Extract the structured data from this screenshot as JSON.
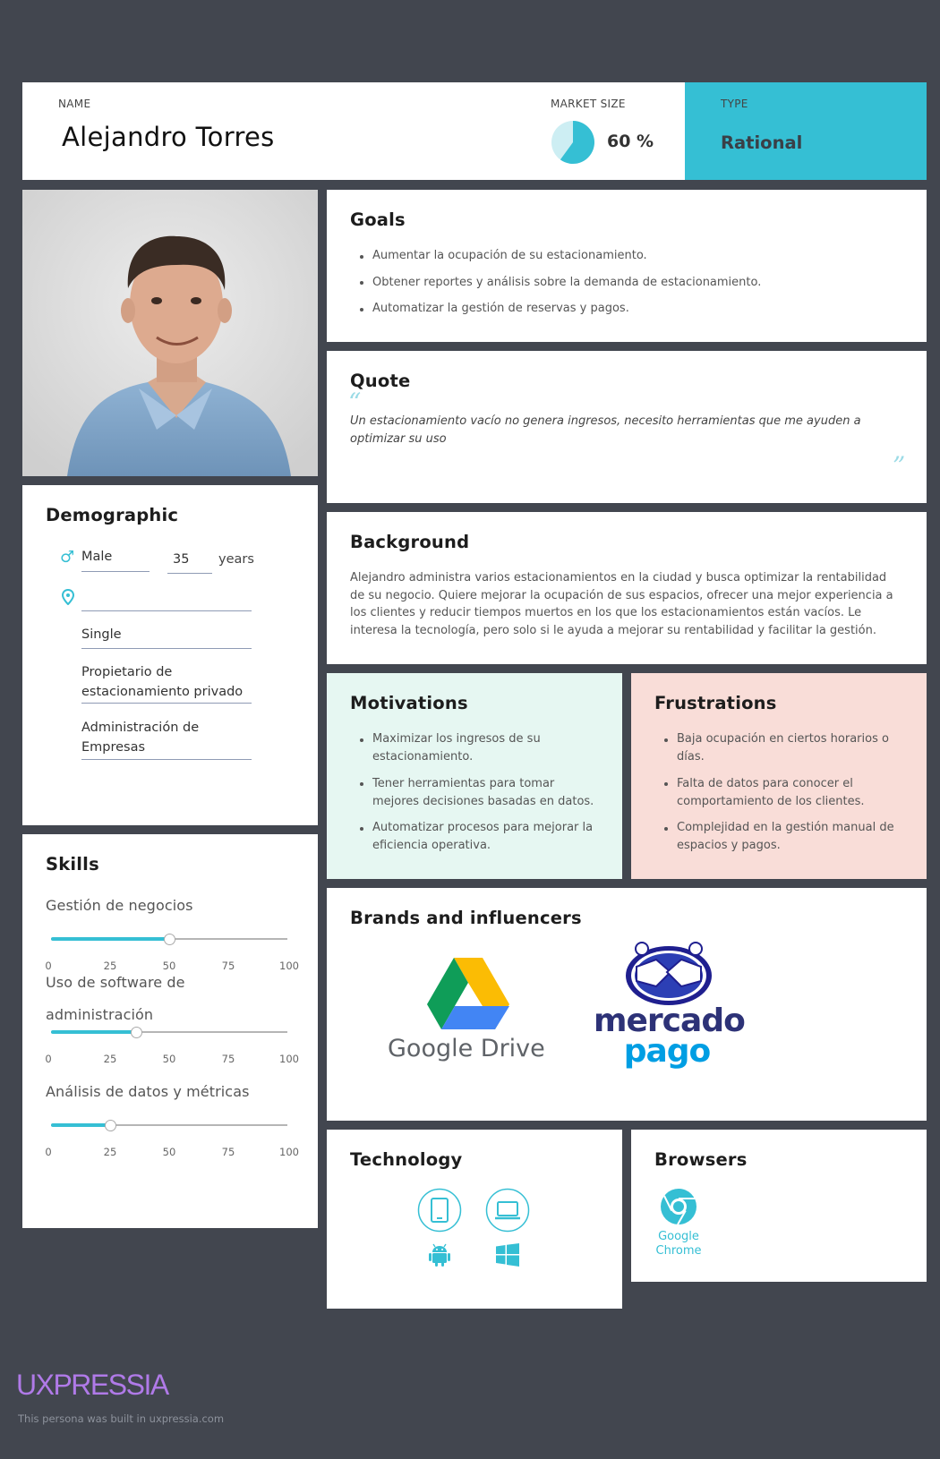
{
  "header": {
    "name_label": "NAME",
    "name": "Alejandro Torres",
    "market_label": "MARKET SIZE",
    "market_value": "60 %",
    "market_fraction": 0.6,
    "type_label": "TYPE",
    "type_value": "Rational"
  },
  "goals": {
    "title": "Goals",
    "items": [
      "Aumentar la ocupación de su estacionamiento.",
      "Obtener reportes y análisis sobre la demanda de estacionamiento.",
      "Automatizar la gestión de reservas y pagos."
    ]
  },
  "quote": {
    "title": "Quote",
    "line1": "Un estacionamiento vacío no genera ingresos, necesito herramientas que me ayuden a",
    "line2": "optimizar su uso"
  },
  "background": {
    "title": "Background",
    "lines": [
      "Alejandro administra varios estacionamientos en la ciudad y busca optimizar la rentabilidad",
      "de su negocio. Quiere mejorar la ocupación de sus espacios, ofrecer una mejor experiencia a",
      "los clientes y reducir tiempos muertos en los que los estacionamientos están vacíos. Le",
      "interesa la tecnología, pero solo si le ayuda a mejorar su rentabilidad y facilitar la gestión."
    ]
  },
  "demographic": {
    "title": "Demographic",
    "gender": "Male",
    "age": "35",
    "age_unit": "years",
    "location": "",
    "status": "Single",
    "occupation_line1": "Propietario de",
    "occupation_line2": "estacionamiento privado",
    "education_line1": "Administración de",
    "education_line2": "Empresas"
  },
  "motivations": {
    "title": "Motivations",
    "items": [
      [
        "Maximizar los ingresos de su",
        "estacionamiento."
      ],
      [
        "Tener herramientas para tomar",
        "mejores decisiones basadas en datos."
      ],
      [
        "Automatizar procesos para mejorar la",
        "eficiencia operativa."
      ]
    ]
  },
  "frustrations": {
    "title": "Frustrations",
    "items": [
      [
        "Baja ocupación en ciertos horarios o",
        "días."
      ],
      [
        "Falta de datos para conocer el",
        "comportamiento de los clientes."
      ],
      [
        "Complejidad en la gestión manual de",
        "espacios y pagos."
      ]
    ]
  },
  "skills": {
    "title": "Skills",
    "ticks": [
      "0",
      "25",
      "50",
      "75",
      "100"
    ],
    "items": [
      {
        "name_line1": "Gestión de negocios",
        "name_line2": "",
        "value": 50
      },
      {
        "name_line1": "Uso de software de",
        "name_line2": "administración",
        "value": 36
      },
      {
        "name_line1": "Análisis de datos y métricas",
        "name_line2": "",
        "value": 25
      }
    ]
  },
  "brands": {
    "title": "Brands and influencers",
    "google_drive_text": "Google Drive",
    "mercado_line1": "mercado",
    "mercado_line2": "pago"
  },
  "technology": {
    "title": "Technology",
    "icons": [
      "tablet-icon",
      "laptop-icon",
      "android-icon",
      "windows-icon"
    ]
  },
  "browsers": {
    "title": "Browsers",
    "browser_line1": "Google",
    "browser_line2": "Chrome"
  },
  "footer": {
    "logo": "UXPRESSIA",
    "note": "This persona was built in uxpressia.com"
  },
  "colors": {
    "accent": "#35bfd4",
    "background": "#42464f",
    "motivations_bg": "#e6f7f2",
    "frustrations_bg": "#f9ddd8",
    "logo": "#b07ae8"
  }
}
